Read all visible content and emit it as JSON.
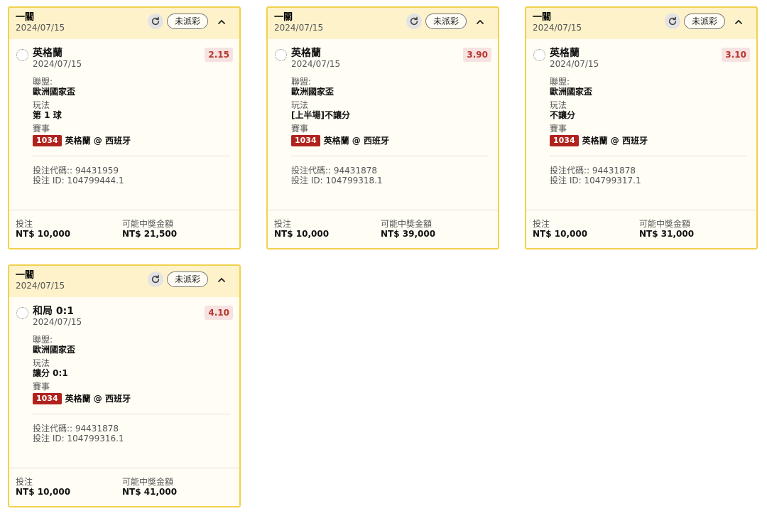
{
  "labels": {
    "league": "聯盟:",
    "play": "玩法",
    "event": "賽事",
    "stake": "投注",
    "payout": "可能中獎金額"
  },
  "cards": [
    {
      "title": "一關",
      "date": "2024/07/15",
      "status": "未派彩",
      "selection": "英格蘭",
      "sel_date": "2024/07/15",
      "odds": "2.15",
      "league": "歐洲國家盃",
      "play": "第 1 球",
      "event_no": "1034",
      "event_name": "英格蘭 @ 西班牙",
      "bet_code": "投注代碼:: 94431959",
      "bet_id": "投注 ID: 104799444.1",
      "stake": "NT$ 10,000",
      "payout": "NT$ 21,500"
    },
    {
      "title": "一關",
      "date": "2024/07/15",
      "status": "未派彩",
      "selection": "英格蘭",
      "sel_date": "2024/07/15",
      "odds": "3.90",
      "league": "歐洲國家盃",
      "play": "[上半場]不讓分",
      "event_no": "1034",
      "event_name": "英格蘭 @ 西班牙",
      "bet_code": "投注代碼:: 94431878",
      "bet_id": "投注 ID: 104799318.1",
      "stake": "NT$ 10,000",
      "payout": "NT$ 39,000"
    },
    {
      "title": "一關",
      "date": "2024/07/15",
      "status": "未派彩",
      "selection": "英格蘭",
      "sel_date": "2024/07/15",
      "odds": "3.10",
      "league": "歐洲國家盃",
      "play": "不讓分",
      "event_no": "1034",
      "event_name": "英格蘭 @ 西班牙",
      "bet_code": "投注代碼:: 94431878",
      "bet_id": "投注 ID: 104799317.1",
      "stake": "NT$ 10,000",
      "payout": "NT$ 31,000"
    },
    {
      "title": "一關",
      "date": "2024/07/15",
      "status": "未派彩",
      "selection": "和局 0:1",
      "sel_date": "2024/07/15",
      "odds": "4.10",
      "league": "歐洲國家盃",
      "play": "讓分 0:1",
      "event_no": "1034",
      "event_name": "英格蘭 @ 西班牙",
      "bet_code": "投注代碼:: 94431878",
      "bet_id": "投注 ID: 104799316.1",
      "stake": "NT$ 10,000",
      "payout": "NT$ 41,000"
    }
  ],
  "colors": {
    "card_border": "#f2d24b",
    "header_bg": "#fdf2ca",
    "odds_text": "#b5362c",
    "event_badge": "#b0231d"
  },
  "icons": {
    "refresh": "refresh-icon",
    "collapse": "chevron-up-icon"
  }
}
